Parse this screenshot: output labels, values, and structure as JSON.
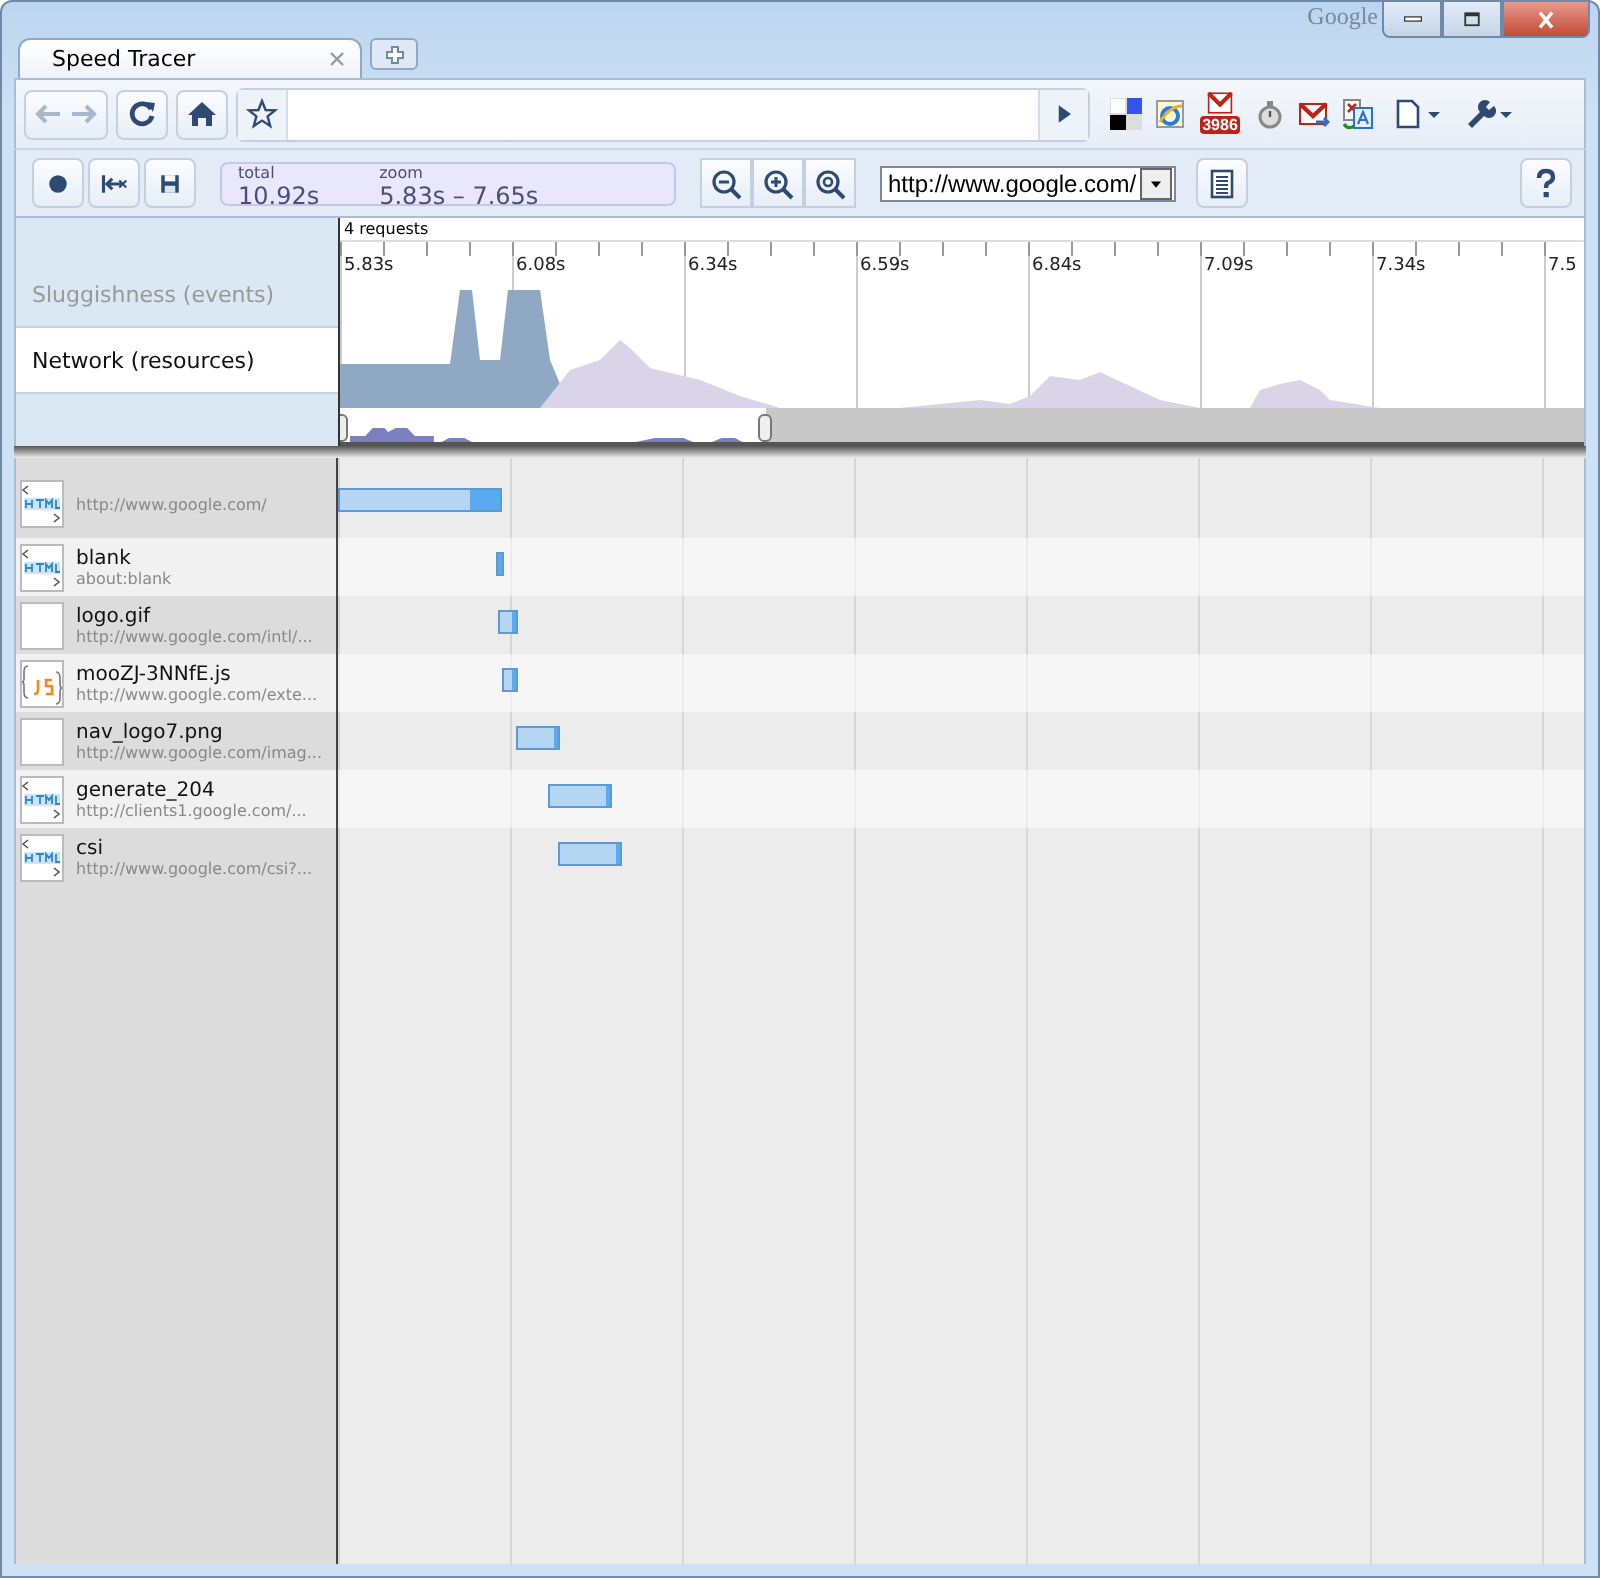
{
  "brand": "Google",
  "tabs": [
    {
      "label": "Speed Tracer",
      "selected": true
    }
  ],
  "mail_badge": "3986",
  "tracer_toolbar": {
    "total_label": "total",
    "total": "10.92s",
    "zoom_label": "zoom",
    "zoom": "5.83s – 7.65s",
    "page_select": "http://www.google.com/"
  },
  "overview": {
    "views": [
      {
        "label": "Sluggishness (events)",
        "selected": false
      },
      {
        "label": "Network (resources)",
        "selected": true
      }
    ],
    "request_count": "4 requests",
    "ticks": [
      "5.83s",
      "6.08s",
      "6.34s",
      "6.59s",
      "6.84s",
      "7.09s",
      "7.34s",
      "7.5"
    ]
  },
  "resources": [
    {
      "kind": "html",
      "url": "http://www.google.com/"
    },
    {
      "kind": "html",
      "name": "blank",
      "url": "about:blank"
    },
    {
      "kind": "blank",
      "name": "logo.gif",
      "url": "http://www.google.com/intl/..."
    },
    {
      "kind": "js",
      "name": "mooZJ-3NNfE.js",
      "url": "http://www.google.com/exte..."
    },
    {
      "kind": "blank",
      "name": "nav_logo7.png",
      "url": "http://www.google.com/imag..."
    },
    {
      "kind": "html",
      "name": "generate_204",
      "url": "http://clients1.google.com/..."
    },
    {
      "kind": "html",
      "name": "csi",
      "url": "http://www.google.com/csi?..."
    }
  ]
}
